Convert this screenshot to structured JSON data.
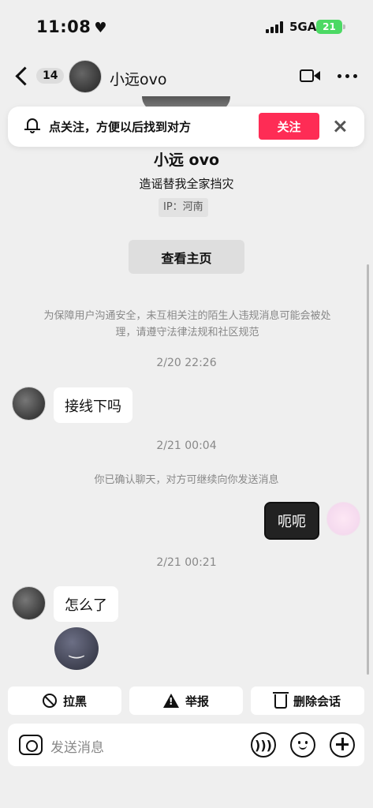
{
  "status_bar": {
    "time": "11:08",
    "heart": "♥",
    "network": "5GA",
    "battery": "21"
  },
  "nav": {
    "unread_count": "14",
    "contact_name": "小远ovo"
  },
  "follow_banner": {
    "text": "点关注，方便以后找到对方",
    "follow_label": "关注"
  },
  "profile": {
    "name": "小远 ovo",
    "bio": "造谣替我全家挡灾",
    "ip": "IP：河南",
    "home_label": "查看主页"
  },
  "notice": "为保障用户沟通安全，未互相关注的陌生人违规消息可能会被处理，请遵守法律法规和社区规范",
  "messages": {
    "ts1": "2/20 22:26",
    "msg1": "接线下吗",
    "ts2": "2/21 00:04",
    "system": "你已确认聊天，对方可继续向你发送消息",
    "msg2": "呃呃",
    "ts3": "2/21 00:21",
    "msg3": "怎么了"
  },
  "actions": {
    "block": "拉黑",
    "report": "举报",
    "delete": "删除会话"
  },
  "input": {
    "placeholder": "发送消息"
  },
  "colors": {
    "accent": "#fe2c55",
    "background": "#efefef"
  }
}
